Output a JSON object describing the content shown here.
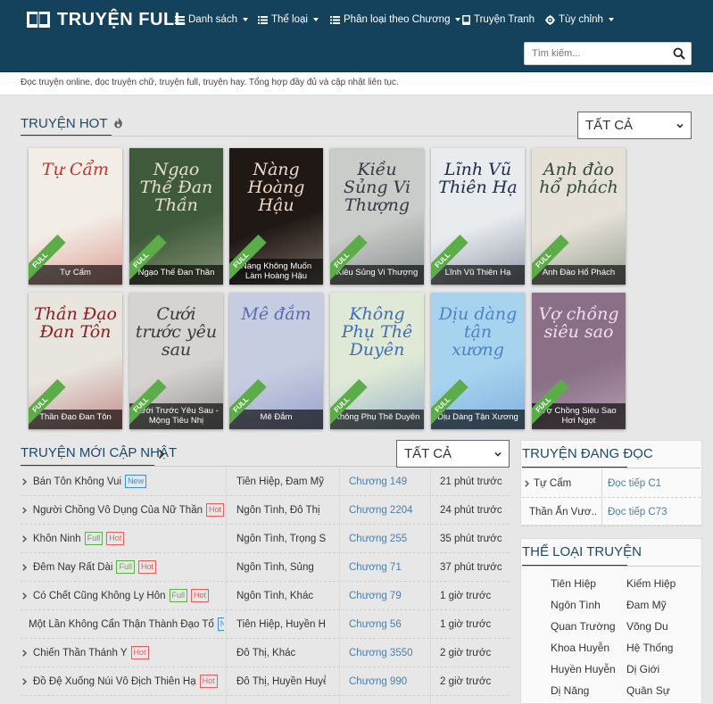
{
  "header": {
    "logo_text": "TRUYỆN FULL",
    "nav": [
      {
        "label": "Danh sách",
        "icon": "list-icon",
        "has_caret": true
      },
      {
        "label": "Thể loại",
        "icon": "list-icon",
        "has_caret": true
      },
      {
        "label": "Phân loại theo Chương",
        "icon": "list-icon",
        "has_caret": true
      },
      {
        "label": "Truyện Tranh",
        "icon": "book-icon",
        "has_caret": false
      },
      {
        "label": "Tùy chỉnh",
        "icon": "gear-icon",
        "has_caret": true
      }
    ],
    "search_placeholder": "Tìm kiếm..."
  },
  "tagline": "Đọc truyện online, đọc truyện chữ, truyện full, truyện hay. Tổng hợp đầy đủ và cập nhật liên tục.",
  "hot": {
    "title": "TRUYỆN HOT",
    "filter": "TẤT CẢ",
    "items": [
      {
        "title": "Tự Cẩm",
        "cover_text": "Tự Cẩm",
        "badge": "FULL",
        "bg": "#f2ede6",
        "accent": "#c0392b"
      },
      {
        "title": "Ngạo Thế Đan Thần",
        "cover_text": "Ngạo Thế Đan Thần",
        "badge": "FULL",
        "bg": "#3f5a3a",
        "accent": "#e8e0c8"
      },
      {
        "title": "Nàng Không Muốn Làm Hoàng Hậu",
        "cover_text": "Nàng Hoàng Hậu",
        "badge": "FULL",
        "bg": "#1f1815",
        "accent": "#f0d9c8"
      },
      {
        "title": "Kiều Sủng Vi Thượng",
        "cover_text": "Kiều Sủng Vi Thượng",
        "badge": "FULL",
        "bg": "#c9ccc8",
        "accent": "#2f3a44"
      },
      {
        "title": "Lĩnh Vũ Thiên Hạ",
        "cover_text": "Lĩnh Vũ Thiên Hạ",
        "badge": "FULL",
        "bg": "#e9ecef",
        "accent": "#1d2a4a"
      },
      {
        "title": "Anh Đào Hổ Phách",
        "cover_text": "Anh đào hổ phách",
        "badge": "FULL",
        "bg": "#e6e1d6",
        "accent": "#2e4a3a"
      },
      {
        "title": "Thần Đạo Đan Tôn",
        "cover_text": "Thần Đạo Đan Tôn",
        "badge": "FULL",
        "bg": "#e8e4de",
        "accent": "#8e1b1b"
      },
      {
        "title": "Cưới Trước Yêu Sau - Mộng Tiêu Nhị",
        "cover_text": "Cưới trước yêu sau",
        "badge": "FULL",
        "bg": "#d6d3d1",
        "accent": "#3a3a3a"
      },
      {
        "title": "Mê Đắm",
        "cover_text": "Mê đắm",
        "badge": "FULL",
        "bg": "#c7cde0",
        "accent": "#5a6bb0"
      },
      {
        "title": "Không Phụ Thê Duyên",
        "cover_text": "Không Phụ Thê Duyên",
        "badge": "FULL",
        "bg": "#dfe9d6",
        "accent": "#3e6fb5"
      },
      {
        "title": "Dịu Dàng Tận Xương",
        "cover_text": "Dịu dàng tận xương",
        "badge": "FULL",
        "bg": "#a8d3ef",
        "accent": "#4b83c7"
      },
      {
        "title": "Vợ Chồng Siêu Sao Hơi Ngọt",
        "cover_text": "Vợ chồng siêu sao",
        "badge": "FULL",
        "bg": "#8a6f86",
        "accent": "#f2dfee"
      }
    ]
  },
  "updates": {
    "title": "TRUYỆN MỚI CẬP NHẬT",
    "filter": "TẤT CẢ",
    "rows": [
      {
        "title": "Bán Tôn Không Vui",
        "labels": [
          {
            "text": "New",
            "kind": "new"
          }
        ],
        "genres": "Tiên Hiệp, Đam Mỹ",
        "chapter": "Chương 149",
        "time": "21 phút trước"
      },
      {
        "title": "Người Chồng Vô Dụng Của Nữ Thần",
        "labels": [
          {
            "text": "Hot",
            "kind": "hot"
          }
        ],
        "genres": "Ngôn Tình, Đô Thị",
        "chapter": "Chương 2204",
        "time": "24 phút trước"
      },
      {
        "title": "Khôn Ninh",
        "labels": [
          {
            "text": "Full",
            "kind": "full"
          },
          {
            "text": "Hot",
            "kind": "hot"
          }
        ],
        "genres": "Ngôn Tình, Trọng Si...",
        "chapter": "Chương 255",
        "time": "35 phút trước"
      },
      {
        "title": "Đêm Nay Rất Dài",
        "labels": [
          {
            "text": "Full",
            "kind": "full"
          },
          {
            "text": "Hot",
            "kind": "hot"
          }
        ],
        "genres": "Ngôn Tình, Sủng",
        "chapter": "Chương 71",
        "time": "37 phút trước"
      },
      {
        "title": "Có Chết Cũng Không Ly Hôn",
        "labels": [
          {
            "text": "Full",
            "kind": "full"
          },
          {
            "text": "Hot",
            "kind": "hot"
          }
        ],
        "genres": "Ngôn Tình, Khác",
        "chapter": "Chương 79",
        "time": "1 giờ trước"
      },
      {
        "title": "Một Lần Không Cẩn Thận Thành Đạo Tổ",
        "labels": [
          {
            "text": "N...",
            "kind": "new"
          }
        ],
        "genres": "Tiên Hiệp, Huyền H...",
        "chapter": "Chương 56",
        "time": "1 giờ trước"
      },
      {
        "title": "Chiến Thần Thánh Y",
        "labels": [
          {
            "text": "Hot",
            "kind": "hot"
          }
        ],
        "genres": "Đô Thị, Khác",
        "chapter": "Chương 3550",
        "time": "2 giờ trước"
      },
      {
        "title": "Đồ Đệ Xuống Núi Vô Địch Thiên Hạ",
        "labels": [
          {
            "text": "Hot",
            "kind": "hot"
          }
        ],
        "genres": "Đô Thị, Huyền Huyễn",
        "chapter": "Chương 990",
        "time": "2 giờ trước"
      }
    ]
  },
  "reading": {
    "title": "TRUYỆN ĐANG ĐỌC",
    "items": [
      {
        "name": "Tự Cẩm",
        "link": "Đọc tiếp C1"
      },
      {
        "name": "Thần Ấn Vươ...",
        "link": "Đọc tiếp C73"
      }
    ]
  },
  "genres": {
    "title": "THỂ LOẠI TRUYỆN",
    "items": [
      "Tiên Hiệp",
      "Kiếm Hiệp",
      "Ngôn Tình",
      "Đam Mỹ",
      "Quan Trường",
      "Võng Du",
      "Khoa Huyễn",
      "Hệ Thống",
      "Huyền Huyễn",
      "Dị Giới",
      "Dị Năng",
      "Quân Sự"
    ]
  },
  "colors": {
    "header_bg": "#14425d",
    "link": "#4e7ea0",
    "label_new": "#3e8fdb",
    "label_hot": "#e55d5d",
    "label_full": "#5cad4a"
  }
}
